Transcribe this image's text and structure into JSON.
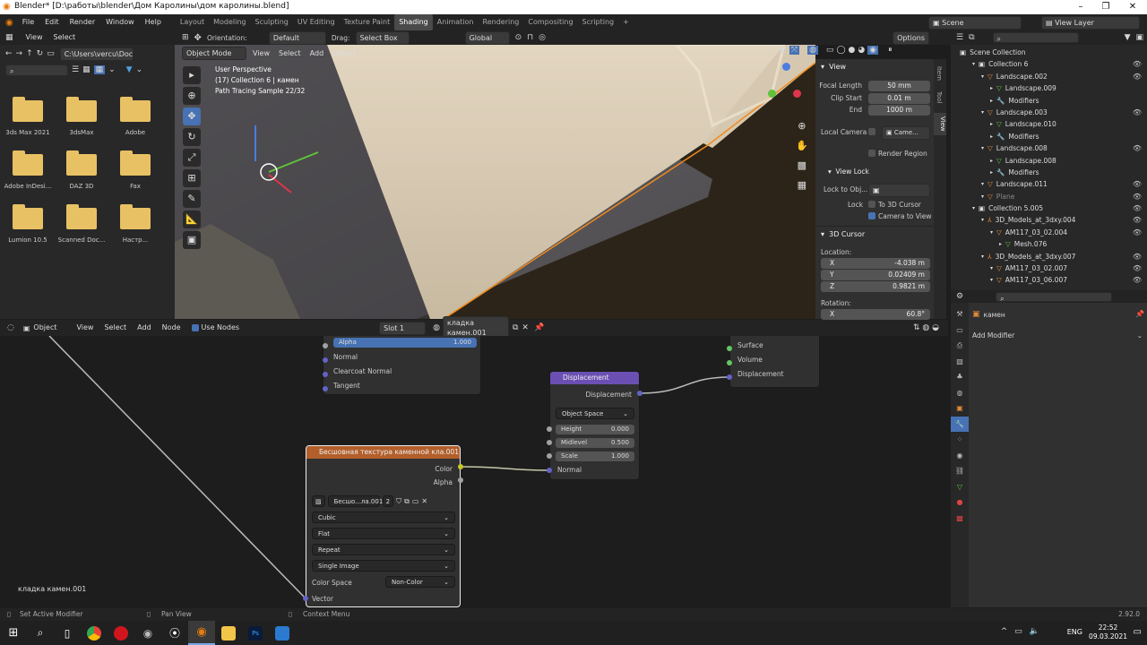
{
  "title": "Blender* [D:\\работы\\blender\\Дом Каролины\\дом каролины.blend]",
  "menu": [
    "File",
    "Edit",
    "Render",
    "Window",
    "Help"
  ],
  "workspaces": [
    "Layout",
    "Modeling",
    "Sculpting",
    "UV Editing",
    "Texture Paint",
    "Shading",
    "Animation",
    "Rendering",
    "Compositing",
    "Scripting"
  ],
  "active_workspace": "Shading",
  "scene": "Scene",
  "view_layer": "View Layer",
  "filebrowser": {
    "menu": [
      "View",
      "Select"
    ],
    "path": "C:\\Users\\vercu\\Docu...",
    "items": [
      "3ds Max 2021",
      "3dsMax",
      "Adobe",
      "Adobe InDesi...",
      "DAZ 3D",
      "Fax",
      "Lumion 10.5",
      "Scanned Doc...",
      "Настр..."
    ]
  },
  "viewport_header": {
    "orientation_label": "Orientation:",
    "orientation": "Default",
    "drag_label": "Drag:",
    "drag": "Select Box",
    "transform": "Global",
    "options": "Options",
    "mode": "Object Mode",
    "menu": [
      "View",
      "Select",
      "Add",
      "Object"
    ]
  },
  "viewport_info": [
    "User Perspective",
    "(17) Collection 6 | камен",
    "Path Tracing Sample 22/32"
  ],
  "npanel": {
    "tabs": [
      "Item",
      "Tool",
      "View"
    ],
    "view_title": "View",
    "focal_length_label": "Focal Length",
    "focal_length": "50 mm",
    "clip_start_label": "Clip Start",
    "clip_start": "0.01 m",
    "end_label": "End",
    "end": "1000 m",
    "local_camera_label": "Local Camera",
    "local_camera": "Came...",
    "render_region": "Render Region",
    "view_lock": "View Lock",
    "lock_to_obj": "Lock to Obj...",
    "lock_label": "Lock",
    "to_3d_cursor": "To 3D Cursor",
    "camera_to_view": "Camera to View",
    "cursor_title": "3D Cursor",
    "location_label": "Location:",
    "x_label": "X",
    "x": "-4.038 m",
    "y_label": "Y",
    "y": "0.02409 m",
    "z_label": "Z",
    "z": "0.9821 m",
    "rotation_label": "Rotation:",
    "rx_label": "X",
    "rx": "60.8°"
  },
  "outliner": {
    "root": "Scene Collection",
    "items": [
      {
        "indent": 1,
        "label": "Collection 6",
        "type": "collection"
      },
      {
        "indent": 2,
        "label": "Landscape.002",
        "type": "object"
      },
      {
        "indent": 3,
        "label": "Landscape.009",
        "type": "mesh"
      },
      {
        "indent": 3,
        "label": "Modifiers",
        "type": "mod"
      },
      {
        "indent": 2,
        "label": "Landscape.003",
        "type": "object"
      },
      {
        "indent": 3,
        "label": "Landscape.010",
        "type": "mesh"
      },
      {
        "indent": 3,
        "label": "Modifiers",
        "type": "mod"
      },
      {
        "indent": 2,
        "label": "Landscape.008",
        "type": "object"
      },
      {
        "indent": 3,
        "label": "Landscape.008",
        "type": "mesh"
      },
      {
        "indent": 3,
        "label": "Modifiers",
        "type": "mod"
      },
      {
        "indent": 2,
        "label": "Landscape.011",
        "type": "object"
      },
      {
        "indent": 2,
        "label": "Plane",
        "type": "object"
      },
      {
        "indent": 1,
        "label": "Collection 5.005",
        "type": "collection"
      },
      {
        "indent": 2,
        "label": "3D_Models_at_3dxy.004",
        "type": "empty"
      },
      {
        "indent": 3,
        "label": "AM117_03_02.004",
        "type": "object"
      },
      {
        "indent": 4,
        "label": "Mesh.076",
        "type": "mesh"
      },
      {
        "indent": 2,
        "label": "3D_Models_at_3dxy.007",
        "type": "empty"
      },
      {
        "indent": 3,
        "label": "AM117_03_02.007",
        "type": "object"
      },
      {
        "indent": 3,
        "label": "AM117_03_06.007",
        "type": "object"
      }
    ]
  },
  "modifier": {
    "object": "камен",
    "add_modifier": "Add Modifier"
  },
  "node_header": {
    "editor": "Object",
    "menu": [
      "View",
      "Select",
      "Add",
      "Node"
    ],
    "use_nodes": "Use Nodes",
    "slot": "Slot 1",
    "material": "кладка камен.001"
  },
  "nodes": {
    "bsdf_alpha_label": "Alpha",
    "bsdf_alpha": "1.000",
    "bsdf_normal": "Normal",
    "bsdf_clearcoat_normal": "Clearcoat Normal",
    "bsdf_tangent": "Tangent",
    "displacement_title": "Displacement",
    "disp_out": "Displacement",
    "disp_space": "Object Space",
    "height_label": "Height",
    "height": "0.000",
    "midlevel_label": "Midlevel",
    "midlevel": "0.500",
    "scale_label": "Scale",
    "scale": "1.000",
    "disp_normal": "Normal",
    "output_surface": "Surface",
    "output_volume": "Volume",
    "output_displacement": "Displacement",
    "tex_title": "Бесшовная текстура каменной кла.001",
    "tex_color": "Color",
    "tex_alpha": "Alpha",
    "tex_image": "Бесшо...ла.001",
    "tex_users": "2",
    "tex_interp": "Cubic",
    "tex_proj": "Flat",
    "tex_ext": "Repeat",
    "tex_source": "Single Image",
    "colorspace_label": "Color Space",
    "colorspace": "Non-Color",
    "tex_vector": "Vector",
    "material_label": "кладка камен.001"
  },
  "statusbar": {
    "left": "Set Active Modifier",
    "mid": "Pan View",
    "right": "Context Menu",
    "version": "2.92.0"
  },
  "taskbar": {
    "lang": "ENG",
    "time": "22:52",
    "date": "09.03.2021"
  },
  "colors": {
    "accent": "#4772b3",
    "node_disp_header": "#6b4fb3",
    "node_tex_header": "#b35f2b",
    "socket_gray": "#a1a1a1",
    "socket_yellow": "#c7c729",
    "socket_purple": "#6363c7",
    "socket_green": "#63c763"
  }
}
